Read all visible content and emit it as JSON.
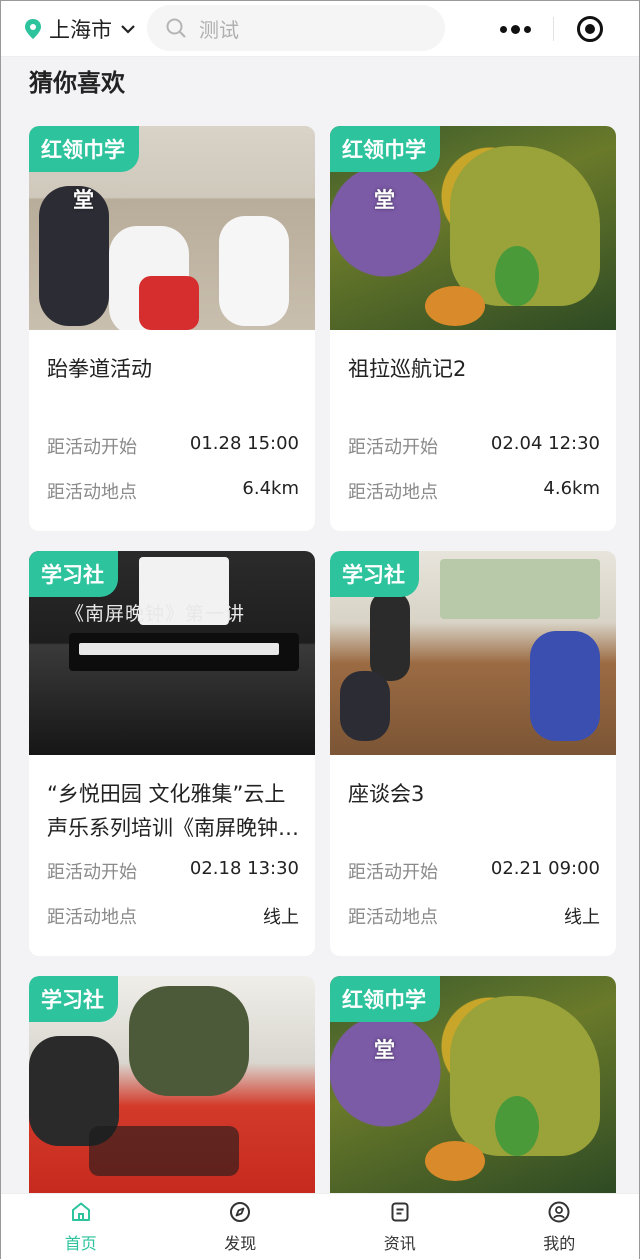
{
  "header": {
    "city": "上海市",
    "search_placeholder": "测试"
  },
  "section_title": "猜你喜欢",
  "cards": [
    {
      "tag": "红领巾学",
      "tag_sub": "堂",
      "title": "跆拳道活动",
      "start_label": "距活动开始",
      "start_value": "01.28 15:00",
      "place_label": "距活动地点",
      "place_value": "6.4km"
    },
    {
      "tag": "红领巾学",
      "tag_sub": "堂",
      "title": "祖拉巡航记2",
      "start_label": "距活动开始",
      "start_value": "02.04 12:30",
      "place_label": "距活动地点",
      "place_value": "4.6km"
    },
    {
      "tag": "学习社",
      "overlay": "《南屏晚钟》第一讲",
      "title": "“乡悦田园 文化雅集”云上声乐系列培训《南屏晚钟》第一讲",
      "start_label": "距活动开始",
      "start_value": "02.18 13:30",
      "place_label": "距活动地点",
      "place_value": "线上"
    },
    {
      "tag": "学习社",
      "title": "座谈会3",
      "start_label": "距活动开始",
      "start_value": "02.21 09:00",
      "place_label": "距活动地点",
      "place_value": "线上"
    },
    {
      "tag": "学习社"
    },
    {
      "tag": "红领巾学",
      "tag_sub": "堂"
    }
  ],
  "tabbar": [
    {
      "label": "首页",
      "icon": "home-icon",
      "active": true
    },
    {
      "label": "发现",
      "icon": "compass-icon",
      "active": false
    },
    {
      "label": "资讯",
      "icon": "news-icon",
      "active": false
    },
    {
      "label": "我的",
      "icon": "profile-icon",
      "active": false
    }
  ],
  "colors": {
    "accent": "#2cc39d",
    "background": "#f3f3f5"
  }
}
